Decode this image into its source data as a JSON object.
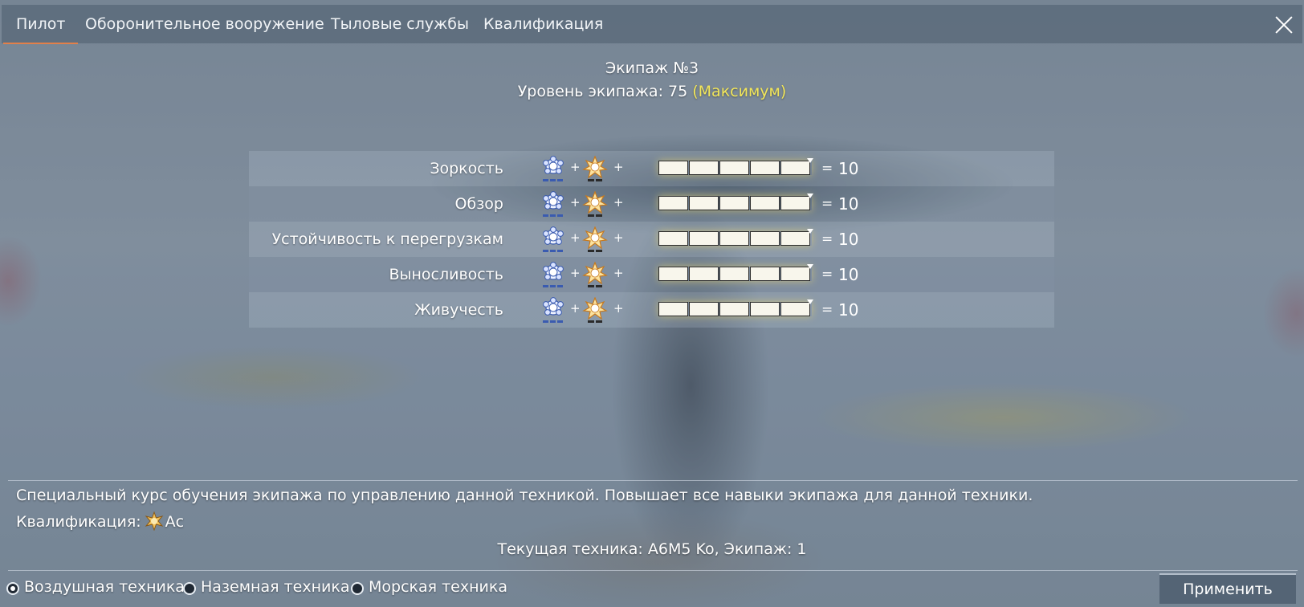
{
  "tabs": [
    {
      "label": "Пилот",
      "active": true
    },
    {
      "label": "Оборонительное вооружение",
      "active": false
    },
    {
      "label": "Тыловые службы",
      "active": false
    },
    {
      "label": "Квалификация",
      "active": false
    }
  ],
  "crew": {
    "title": "Экипаж №3",
    "level_label": "Уровень экипажа: 75",
    "level_max": "(Максимум)"
  },
  "skills": [
    {
      "name": "Зоркость",
      "plus1": "+",
      "plus2": "+",
      "eq": "=",
      "value": "10",
      "bar_fill": 1.0
    },
    {
      "name": "Обзор",
      "plus1": "+",
      "plus2": "+",
      "eq": "=",
      "value": "10",
      "bar_fill": 1.0
    },
    {
      "name": "Устойчивость к перегрузкам",
      "plus1": "+",
      "plus2": "+",
      "eq": "=",
      "value": "10",
      "bar_fill": 1.0
    },
    {
      "name": "Выносливость",
      "plus1": "+",
      "plus2": "+",
      "eq": "=",
      "value": "10",
      "bar_fill": 1.0
    },
    {
      "name": "Живучесть",
      "plus1": "+",
      "plus2": "+",
      "eq": "=",
      "value": "10",
      "bar_fill": 1.0
    }
  ],
  "info": {
    "description": "Специальный курс обучения экипажа по управлению данной техникой. Повышает все навыки экипажа для данной техники.",
    "qualification_label": "Квалификация:",
    "qualification_value": "Ас",
    "current_vehicle": "Текущая техника: A6M5 Ko, Экипаж: 1"
  },
  "vehicle_types": [
    {
      "label": "Воздушная техника",
      "checked": true
    },
    {
      "label": "Наземная техника",
      "checked": false
    },
    {
      "label": "Морская техника",
      "checked": false
    }
  ],
  "apply_label": "Применить",
  "colors": {
    "accent_tab": "#e2804a",
    "max_highlight": "#f2e65a",
    "medal_blue": "#3a5bb0",
    "medal_gold": "#e8a53a"
  },
  "icons": {
    "close": "close-icon",
    "medal_expert": "blue-medal-icon",
    "medal_ace": "gold-star-medal-icon"
  }
}
